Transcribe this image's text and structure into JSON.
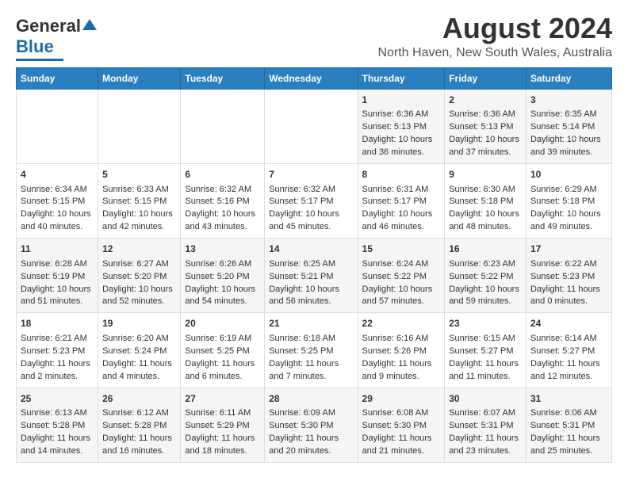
{
  "logo": {
    "line1": "General",
    "line2": "Blue"
  },
  "title": "August 2024",
  "subtitle": "North Haven, New South Wales, Australia",
  "headers": [
    "Sunday",
    "Monday",
    "Tuesday",
    "Wednesday",
    "Thursday",
    "Friday",
    "Saturday"
  ],
  "weeks": [
    [
      {
        "day": "",
        "sunrise": "",
        "sunset": "",
        "daylight": ""
      },
      {
        "day": "",
        "sunrise": "",
        "sunset": "",
        "daylight": ""
      },
      {
        "day": "",
        "sunrise": "",
        "sunset": "",
        "daylight": ""
      },
      {
        "day": "",
        "sunrise": "",
        "sunset": "",
        "daylight": ""
      },
      {
        "day": "1",
        "sunrise": "Sunrise: 6:36 AM",
        "sunset": "Sunset: 5:13 PM",
        "daylight": "Daylight: 10 hours and 36 minutes."
      },
      {
        "day": "2",
        "sunrise": "Sunrise: 6:36 AM",
        "sunset": "Sunset: 5:13 PM",
        "daylight": "Daylight: 10 hours and 37 minutes."
      },
      {
        "day": "3",
        "sunrise": "Sunrise: 6:35 AM",
        "sunset": "Sunset: 5:14 PM",
        "daylight": "Daylight: 10 hours and 39 minutes."
      }
    ],
    [
      {
        "day": "4",
        "sunrise": "Sunrise: 6:34 AM",
        "sunset": "Sunset: 5:15 PM",
        "daylight": "Daylight: 10 hours and 40 minutes."
      },
      {
        "day": "5",
        "sunrise": "Sunrise: 6:33 AM",
        "sunset": "Sunset: 5:15 PM",
        "daylight": "Daylight: 10 hours and 42 minutes."
      },
      {
        "day": "6",
        "sunrise": "Sunrise: 6:32 AM",
        "sunset": "Sunset: 5:16 PM",
        "daylight": "Daylight: 10 hours and 43 minutes."
      },
      {
        "day": "7",
        "sunrise": "Sunrise: 6:32 AM",
        "sunset": "Sunset: 5:17 PM",
        "daylight": "Daylight: 10 hours and 45 minutes."
      },
      {
        "day": "8",
        "sunrise": "Sunrise: 6:31 AM",
        "sunset": "Sunset: 5:17 PM",
        "daylight": "Daylight: 10 hours and 46 minutes."
      },
      {
        "day": "9",
        "sunrise": "Sunrise: 6:30 AM",
        "sunset": "Sunset: 5:18 PM",
        "daylight": "Daylight: 10 hours and 48 minutes."
      },
      {
        "day": "10",
        "sunrise": "Sunrise: 6:29 AM",
        "sunset": "Sunset: 5:18 PM",
        "daylight": "Daylight: 10 hours and 49 minutes."
      }
    ],
    [
      {
        "day": "11",
        "sunrise": "Sunrise: 6:28 AM",
        "sunset": "Sunset: 5:19 PM",
        "daylight": "Daylight: 10 hours and 51 minutes."
      },
      {
        "day": "12",
        "sunrise": "Sunrise: 6:27 AM",
        "sunset": "Sunset: 5:20 PM",
        "daylight": "Daylight: 10 hours and 52 minutes."
      },
      {
        "day": "13",
        "sunrise": "Sunrise: 6:26 AM",
        "sunset": "Sunset: 5:20 PM",
        "daylight": "Daylight: 10 hours and 54 minutes."
      },
      {
        "day": "14",
        "sunrise": "Sunrise: 6:25 AM",
        "sunset": "Sunset: 5:21 PM",
        "daylight": "Daylight: 10 hours and 56 minutes."
      },
      {
        "day": "15",
        "sunrise": "Sunrise: 6:24 AM",
        "sunset": "Sunset: 5:22 PM",
        "daylight": "Daylight: 10 hours and 57 minutes."
      },
      {
        "day": "16",
        "sunrise": "Sunrise: 6:23 AM",
        "sunset": "Sunset: 5:22 PM",
        "daylight": "Daylight: 10 hours and 59 minutes."
      },
      {
        "day": "17",
        "sunrise": "Sunrise: 6:22 AM",
        "sunset": "Sunset: 5:23 PM",
        "daylight": "Daylight: 11 hours and 0 minutes."
      }
    ],
    [
      {
        "day": "18",
        "sunrise": "Sunrise: 6:21 AM",
        "sunset": "Sunset: 5:23 PM",
        "daylight": "Daylight: 11 hours and 2 minutes."
      },
      {
        "day": "19",
        "sunrise": "Sunrise: 6:20 AM",
        "sunset": "Sunset: 5:24 PM",
        "daylight": "Daylight: 11 hours and 4 minutes."
      },
      {
        "day": "20",
        "sunrise": "Sunrise: 6:19 AM",
        "sunset": "Sunset: 5:25 PM",
        "daylight": "Daylight: 11 hours and 6 minutes."
      },
      {
        "day": "21",
        "sunrise": "Sunrise: 6:18 AM",
        "sunset": "Sunset: 5:25 PM",
        "daylight": "Daylight: 11 hours and 7 minutes."
      },
      {
        "day": "22",
        "sunrise": "Sunrise: 6:16 AM",
        "sunset": "Sunset: 5:26 PM",
        "daylight": "Daylight: 11 hours and 9 minutes."
      },
      {
        "day": "23",
        "sunrise": "Sunrise: 6:15 AM",
        "sunset": "Sunset: 5:27 PM",
        "daylight": "Daylight: 11 hours and 11 minutes."
      },
      {
        "day": "24",
        "sunrise": "Sunrise: 6:14 AM",
        "sunset": "Sunset: 5:27 PM",
        "daylight": "Daylight: 11 hours and 12 minutes."
      }
    ],
    [
      {
        "day": "25",
        "sunrise": "Sunrise: 6:13 AM",
        "sunset": "Sunset: 5:28 PM",
        "daylight": "Daylight: 11 hours and 14 minutes."
      },
      {
        "day": "26",
        "sunrise": "Sunrise: 6:12 AM",
        "sunset": "Sunset: 5:28 PM",
        "daylight": "Daylight: 11 hours and 16 minutes."
      },
      {
        "day": "27",
        "sunrise": "Sunrise: 6:11 AM",
        "sunset": "Sunset: 5:29 PM",
        "daylight": "Daylight: 11 hours and 18 minutes."
      },
      {
        "day": "28",
        "sunrise": "Sunrise: 6:09 AM",
        "sunset": "Sunset: 5:30 PM",
        "daylight": "Daylight: 11 hours and 20 minutes."
      },
      {
        "day": "29",
        "sunrise": "Sunrise: 6:08 AM",
        "sunset": "Sunset: 5:30 PM",
        "daylight": "Daylight: 11 hours and 21 minutes."
      },
      {
        "day": "30",
        "sunrise": "Sunrise: 6:07 AM",
        "sunset": "Sunset: 5:31 PM",
        "daylight": "Daylight: 11 hours and 23 minutes."
      },
      {
        "day": "31",
        "sunrise": "Sunrise: 6:06 AM",
        "sunset": "Sunset: 5:31 PM",
        "daylight": "Daylight: 11 hours and 25 minutes."
      }
    ]
  ]
}
